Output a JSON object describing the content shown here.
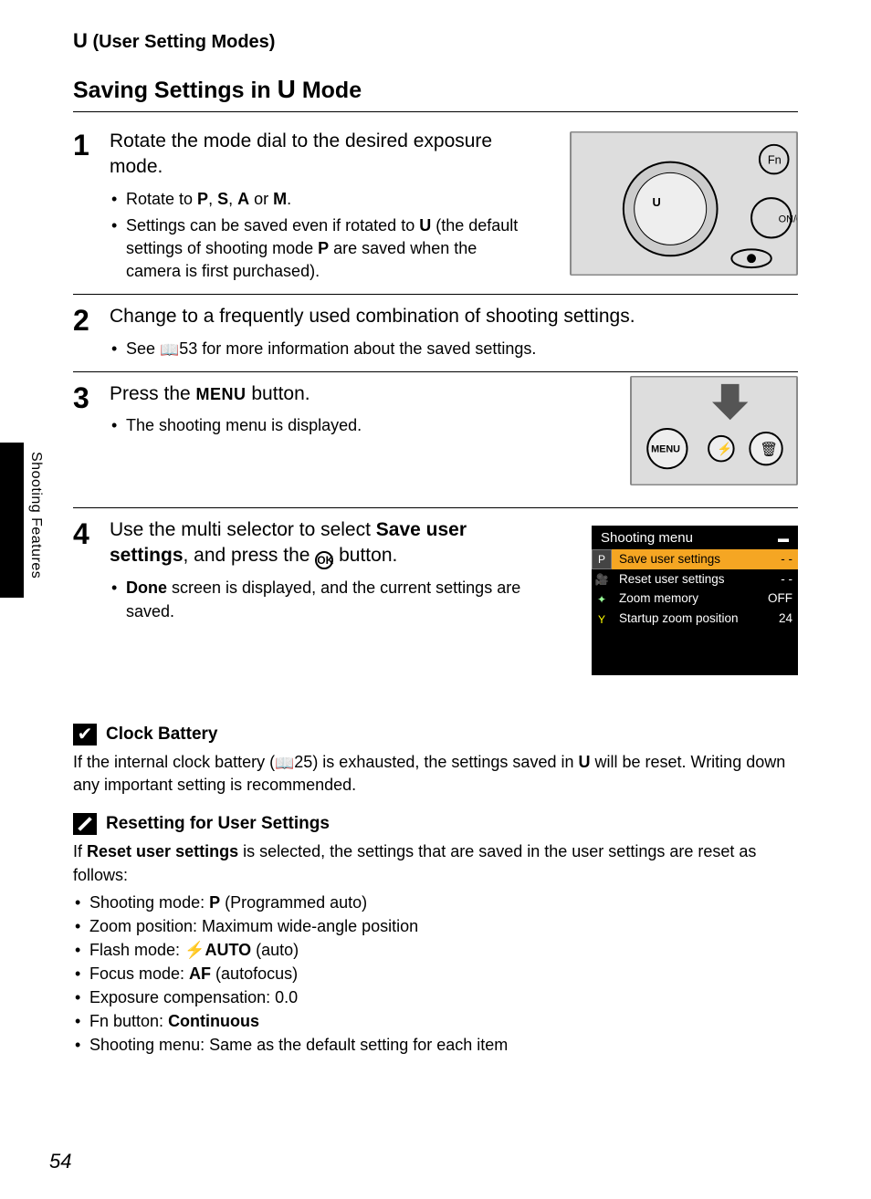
{
  "header": {
    "glyph": "U",
    "text": " (User Setting Modes)"
  },
  "title_pre": "Saving Settings in ",
  "title_glyph": "U",
  "title_post": " Mode",
  "side_label": "Shooting Features",
  "steps": {
    "s1": {
      "num": "1",
      "title": "Rotate the mode dial to the desired exposure mode.",
      "b1_pre": "Rotate to ",
      "P": "P",
      "c1": ", ",
      "S": "S",
      "c2": ", ",
      "A": "A",
      "or": " or ",
      "M": "M",
      "dot": ".",
      "b2_pre": "Settings can be saved even if rotated to ",
      "U": "U",
      "b2_mid": " (the default settings of shooting mode ",
      "P2": "P",
      "b2_post": " are saved when the camera is first purchased)."
    },
    "s2": {
      "num": "2",
      "title": "Change to a frequently used combination of shooting settings.",
      "b1_pre": "See ",
      "page": "53",
      "b1_post": " for more information about the saved settings."
    },
    "s3": {
      "num": "3",
      "title_pre": "Press the ",
      "title_menu": "MENU",
      "title_post": " button.",
      "b1": "The shooting menu is displayed."
    },
    "s4": {
      "num": "4",
      "title_pre": "Use the multi selector to select ",
      "title_bold": "Save user settings",
      "title_mid": ", and press the ",
      "title_ok": "OK",
      "title_post": " button.",
      "b1_bold": "Done",
      "b1_post": " screen is displayed, and the current settings are saved."
    }
  },
  "menu": {
    "title": "Shooting menu",
    "r1": {
      "label": "Save user settings",
      "val": "- -"
    },
    "r2": {
      "label": "Reset user settings",
      "val": "- -"
    },
    "r3": {
      "label": "Zoom memory",
      "val": "OFF"
    },
    "r4": {
      "label": "Startup zoom position",
      "val": "24"
    }
  },
  "notes": {
    "clock": {
      "title": "Clock Battery",
      "text_pre": "If the internal clock battery (",
      "page": "25",
      "text_mid": ") is exhausted, the settings saved in ",
      "U": "U",
      "text_post": " will be reset. Writing down any important setting is recommended."
    },
    "reset": {
      "title": "Resetting for User Settings",
      "intro_pre": "If ",
      "intro_bold": "Reset user settings",
      "intro_post": " is selected, the settings that are saved in the user settings are reset as follows:",
      "li1_pre": "Shooting mode: ",
      "li1_g": "P",
      "li1_post": " (Programmed auto)",
      "li2": "Zoom position: Maximum wide-angle position",
      "li3_pre": "Flash mode: ",
      "li3_g": "⚡AUTO",
      "li3_post": " (auto)",
      "li4_pre": "Focus mode: ",
      "li4_g": "AF",
      "li4_post": " (autofocus)",
      "li5": "Exposure compensation: 0.0",
      "li6_pre": "Fn button: ",
      "li6_b": "Continuous",
      "li7": "Shooting menu: Same as the default setting for each item"
    }
  },
  "page_number": "54"
}
